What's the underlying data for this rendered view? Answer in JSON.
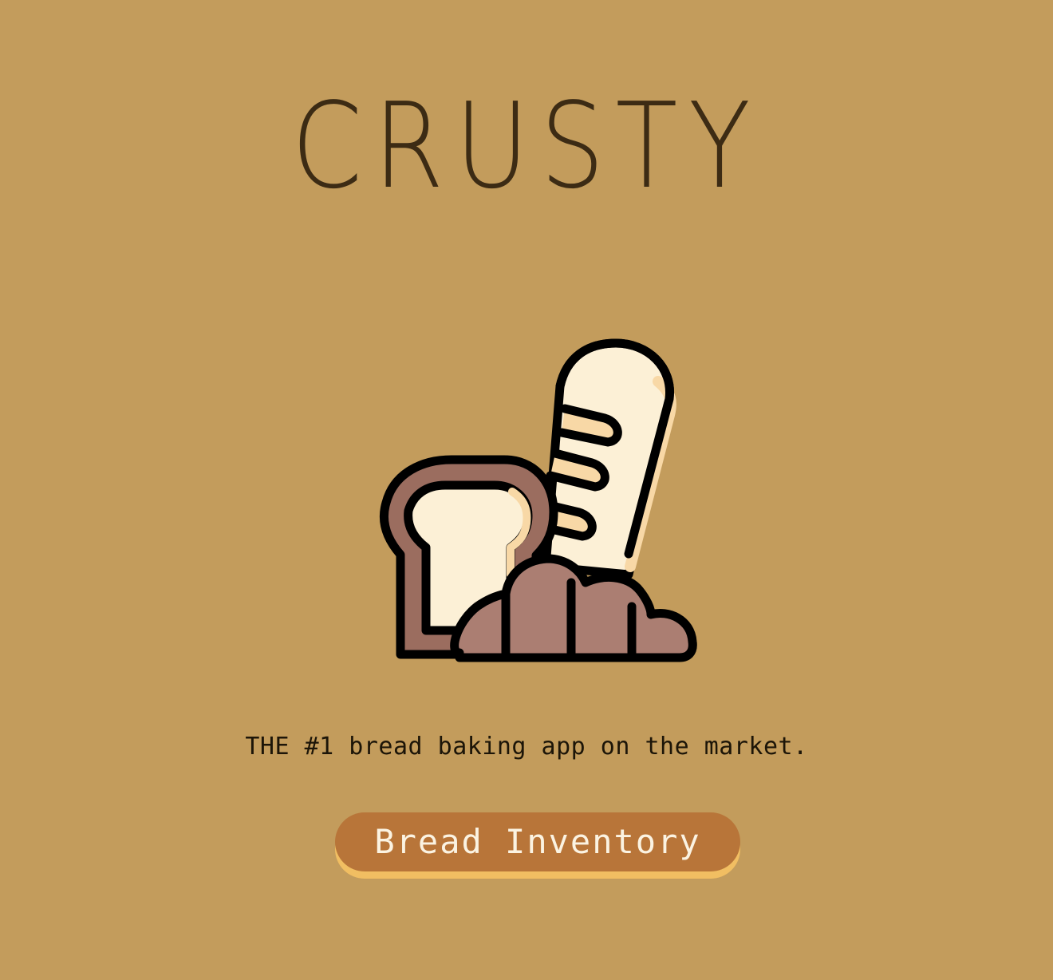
{
  "app": {
    "title": "CRUSTY",
    "tagline": "THE #1 bread baking app on the market."
  },
  "hero": {
    "icon": "bread-assortment-icon"
  },
  "cta": {
    "label": "Bread Inventory"
  },
  "colors": {
    "background": "#c39c5c",
    "title": "#3c2b14",
    "button": "#b87539",
    "button_shadow": "#f1be62",
    "button_text": "#fbf3e2"
  }
}
